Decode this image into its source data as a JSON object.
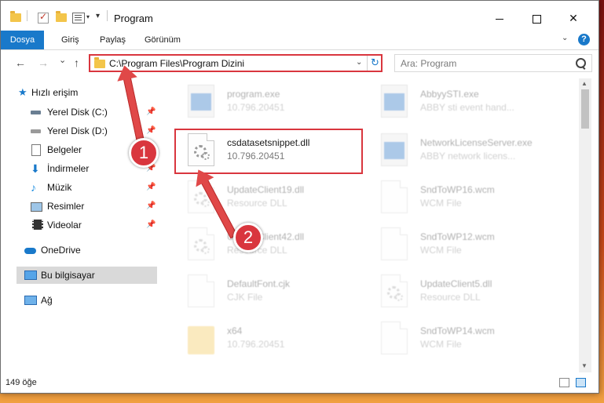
{
  "window": {
    "title": "Program",
    "min_glyph": "",
    "close_glyph": "✕"
  },
  "ribbon": {
    "tabs": [
      "Dosya",
      "Giriş",
      "Paylaş",
      "Görünüm"
    ],
    "help_glyph": "?",
    "accent": "#1979ca"
  },
  "nav": {
    "back_glyph": "←",
    "forward_glyph": "→",
    "recent_glyph": "⌄",
    "up_glyph": "↑",
    "address": "C:\\Program Files\\Program Dizini",
    "search_placeholder": "Ara: Program"
  },
  "sidebar": {
    "items": [
      {
        "label": "Hızlı erişim",
        "icon": "star-icon"
      },
      {
        "label": "Yerel Disk (C:)",
        "icon": "drive-icon",
        "pinned": true
      },
      {
        "label": "Yerel Disk (D:)",
        "icon": "drive-icon",
        "pinned": true
      },
      {
        "label": "Belgeler",
        "icon": "document-icon",
        "pinned": true
      },
      {
        "label": "İndirmeler",
        "icon": "download-icon",
        "pinned": true
      },
      {
        "label": "Müzik",
        "icon": "music-icon",
        "pinned": true
      },
      {
        "label": "Resimler",
        "icon": "pictures-icon",
        "pinned": true
      },
      {
        "label": "Videolar",
        "icon": "video-icon",
        "pinned": true
      },
      {
        "label": "OneDrive",
        "icon": "cloud-icon"
      },
      {
        "label": "Bu bilgisayar",
        "icon": "computer-icon",
        "selected": true
      },
      {
        "label": "Ağ",
        "icon": "network-icon"
      }
    ]
  },
  "files": [
    {
      "name": "program.exe",
      "meta": "10.796.20451",
      "icon": "exe",
      "ghost": true
    },
    {
      "name": "AbbyySTI.exe",
      "meta": "ABBY sti event hand...",
      "icon": "exe",
      "ghost": true
    },
    {
      "name": "csdatasetsnippet.dll",
      "meta": "10.796.20451",
      "icon": "dll",
      "ghost": false
    },
    {
      "name": "NetworkLicenseServer.exe",
      "meta": "ABBY network licens...",
      "icon": "exe",
      "ghost": true
    },
    {
      "name": "UpdateClient19.dll",
      "meta": "Resource DLL",
      "icon": "dll",
      "ghost": true
    },
    {
      "name": "SndToWP16.wcm",
      "meta": "WCM File",
      "icon": "page",
      "ghost": true
    },
    {
      "name": "UpdateClient42.dll",
      "meta": "Resource DLL",
      "icon": "dll",
      "ghost": true
    },
    {
      "name": "SndToWP12.wcm",
      "meta": "WCM File",
      "icon": "page",
      "ghost": true
    },
    {
      "name": "DefaultFont.cjk",
      "meta": "CJK File",
      "icon": "page",
      "ghost": true
    },
    {
      "name": "UpdateClient5.dll",
      "meta": "Resource DLL",
      "icon": "dll",
      "ghost": true
    },
    {
      "name": "x64",
      "meta": "10.796.20451",
      "icon": "folder",
      "ghost": true
    },
    {
      "name": "SndToWP14.wcm",
      "meta": "WCM File",
      "icon": "page",
      "ghost": true
    }
  ],
  "status": {
    "count": "149 öğe"
  },
  "annotations": {
    "badge1": "1",
    "badge2": "2",
    "color": "#d9363e"
  }
}
